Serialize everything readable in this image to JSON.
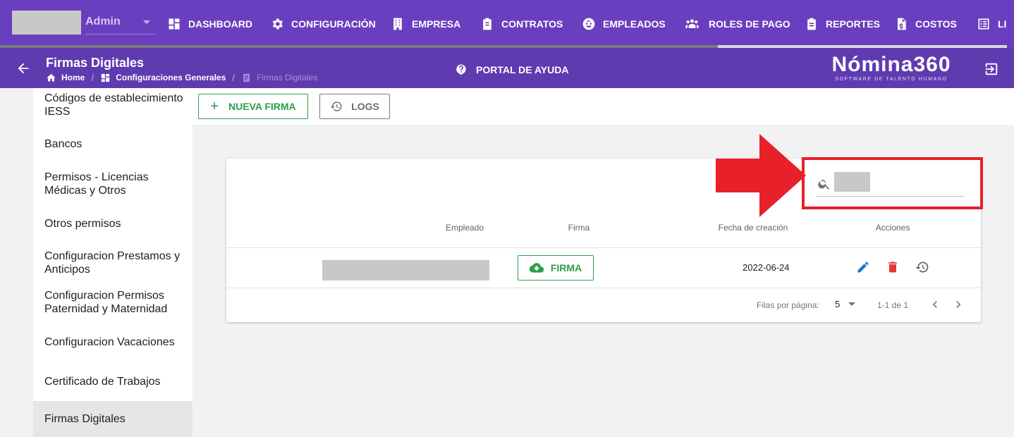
{
  "account": {
    "name": "Admin"
  },
  "nav": [
    {
      "label": "DASHBOARD",
      "icon": "dashboard-icon"
    },
    {
      "label": "CONFIGURACIÓN",
      "icon": "gear-icon"
    },
    {
      "label": "EMPRESA",
      "icon": "building-icon"
    },
    {
      "label": "CONTRATOS",
      "icon": "clipboard-icon"
    },
    {
      "label": "EMPLEADOS",
      "icon": "face-icon"
    },
    {
      "label": "ROLES DE PAGO",
      "icon": "people-icon"
    },
    {
      "label": "REPORTES",
      "icon": "report-icon"
    },
    {
      "label": "COSTOS",
      "icon": "cost-document-icon"
    },
    {
      "label": "LI",
      "icon": "list-icon"
    }
  ],
  "header": {
    "title": "Firmas Digitales",
    "breadcrumb": [
      "Home",
      "Configuraciones Generales",
      "Firmas Digitales"
    ],
    "help_label": "PORTAL DE AYUDA",
    "logo_main": "Nómina360",
    "logo_sub": "SOFTWARE DE TALENTO HUMANO"
  },
  "sidebar": {
    "items": [
      "Códigos de establecimiento IESS",
      "Bancos",
      "Permisos - Licencias Médicas y Otros",
      "Otros permisos",
      "Configuracion Prestamos y Anticipos",
      "Configuracion Permisos Paternidad y Maternidad",
      "Configuracion Vacaciones",
      "Certificado de Trabajos",
      "Firmas Digitales"
    ],
    "active": "Firmas Digitales"
  },
  "toolbar": {
    "new_label": "NUEVA FIRMA",
    "logs_label": "LOGS"
  },
  "table": {
    "search_placeholder": "",
    "columns": [
      "Empleado",
      "Firma",
      "Fecha de creación",
      "Acciones"
    ],
    "rows": [
      {
        "employee": "",
        "firma_label": "FIRMA",
        "date": "2022-06-24"
      }
    ],
    "footer": {
      "rows_per_page_label": "Filas por página:",
      "rows_per_page": "5",
      "range": "1-1 de 1"
    }
  },
  "colors": {
    "primary": "#6a3fbf",
    "subheader": "#5f3bb0",
    "success": "#2e9e4a",
    "annotation": "#e8202a"
  }
}
